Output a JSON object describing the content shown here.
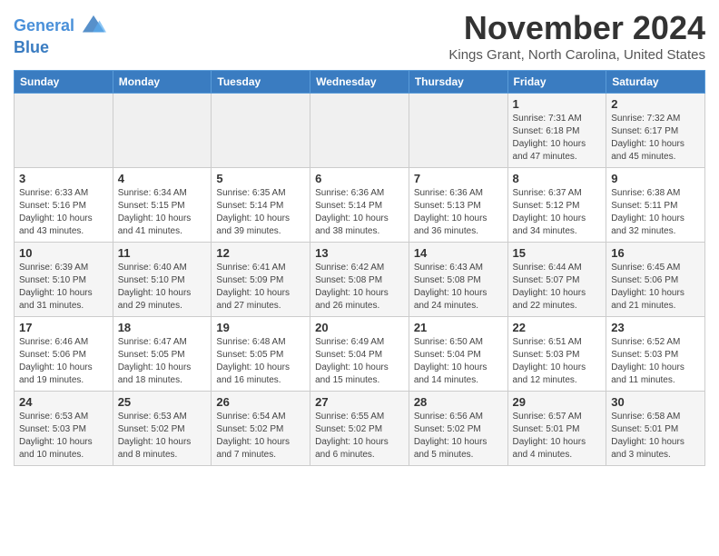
{
  "logo": {
    "line1": "General",
    "line2": "Blue"
  },
  "title": "November 2024",
  "location": "Kings Grant, North Carolina, United States",
  "days_of_week": [
    "Sunday",
    "Monday",
    "Tuesday",
    "Wednesday",
    "Thursday",
    "Friday",
    "Saturday"
  ],
  "weeks": [
    [
      {
        "day": "",
        "content": ""
      },
      {
        "day": "",
        "content": ""
      },
      {
        "day": "",
        "content": ""
      },
      {
        "day": "",
        "content": ""
      },
      {
        "day": "",
        "content": ""
      },
      {
        "day": "1",
        "content": "Sunrise: 7:31 AM\nSunset: 6:18 PM\nDaylight: 10 hours\nand 47 minutes."
      },
      {
        "day": "2",
        "content": "Sunrise: 7:32 AM\nSunset: 6:17 PM\nDaylight: 10 hours\nand 45 minutes."
      }
    ],
    [
      {
        "day": "3",
        "content": "Sunrise: 6:33 AM\nSunset: 5:16 PM\nDaylight: 10 hours\nand 43 minutes."
      },
      {
        "day": "4",
        "content": "Sunrise: 6:34 AM\nSunset: 5:15 PM\nDaylight: 10 hours\nand 41 minutes."
      },
      {
        "day": "5",
        "content": "Sunrise: 6:35 AM\nSunset: 5:14 PM\nDaylight: 10 hours\nand 39 minutes."
      },
      {
        "day": "6",
        "content": "Sunrise: 6:36 AM\nSunset: 5:14 PM\nDaylight: 10 hours\nand 38 minutes."
      },
      {
        "day": "7",
        "content": "Sunrise: 6:36 AM\nSunset: 5:13 PM\nDaylight: 10 hours\nand 36 minutes."
      },
      {
        "day": "8",
        "content": "Sunrise: 6:37 AM\nSunset: 5:12 PM\nDaylight: 10 hours\nand 34 minutes."
      },
      {
        "day": "9",
        "content": "Sunrise: 6:38 AM\nSunset: 5:11 PM\nDaylight: 10 hours\nand 32 minutes."
      }
    ],
    [
      {
        "day": "10",
        "content": "Sunrise: 6:39 AM\nSunset: 5:10 PM\nDaylight: 10 hours\nand 31 minutes."
      },
      {
        "day": "11",
        "content": "Sunrise: 6:40 AM\nSunset: 5:10 PM\nDaylight: 10 hours\nand 29 minutes."
      },
      {
        "day": "12",
        "content": "Sunrise: 6:41 AM\nSunset: 5:09 PM\nDaylight: 10 hours\nand 27 minutes."
      },
      {
        "day": "13",
        "content": "Sunrise: 6:42 AM\nSunset: 5:08 PM\nDaylight: 10 hours\nand 26 minutes."
      },
      {
        "day": "14",
        "content": "Sunrise: 6:43 AM\nSunset: 5:08 PM\nDaylight: 10 hours\nand 24 minutes."
      },
      {
        "day": "15",
        "content": "Sunrise: 6:44 AM\nSunset: 5:07 PM\nDaylight: 10 hours\nand 22 minutes."
      },
      {
        "day": "16",
        "content": "Sunrise: 6:45 AM\nSunset: 5:06 PM\nDaylight: 10 hours\nand 21 minutes."
      }
    ],
    [
      {
        "day": "17",
        "content": "Sunrise: 6:46 AM\nSunset: 5:06 PM\nDaylight: 10 hours\nand 19 minutes."
      },
      {
        "day": "18",
        "content": "Sunrise: 6:47 AM\nSunset: 5:05 PM\nDaylight: 10 hours\nand 18 minutes."
      },
      {
        "day": "19",
        "content": "Sunrise: 6:48 AM\nSunset: 5:05 PM\nDaylight: 10 hours\nand 16 minutes."
      },
      {
        "day": "20",
        "content": "Sunrise: 6:49 AM\nSunset: 5:04 PM\nDaylight: 10 hours\nand 15 minutes."
      },
      {
        "day": "21",
        "content": "Sunrise: 6:50 AM\nSunset: 5:04 PM\nDaylight: 10 hours\nand 14 minutes."
      },
      {
        "day": "22",
        "content": "Sunrise: 6:51 AM\nSunset: 5:03 PM\nDaylight: 10 hours\nand 12 minutes."
      },
      {
        "day": "23",
        "content": "Sunrise: 6:52 AM\nSunset: 5:03 PM\nDaylight: 10 hours\nand 11 minutes."
      }
    ],
    [
      {
        "day": "24",
        "content": "Sunrise: 6:53 AM\nSunset: 5:03 PM\nDaylight: 10 hours\nand 10 minutes."
      },
      {
        "day": "25",
        "content": "Sunrise: 6:53 AM\nSunset: 5:02 PM\nDaylight: 10 hours\nand 8 minutes."
      },
      {
        "day": "26",
        "content": "Sunrise: 6:54 AM\nSunset: 5:02 PM\nDaylight: 10 hours\nand 7 minutes."
      },
      {
        "day": "27",
        "content": "Sunrise: 6:55 AM\nSunset: 5:02 PM\nDaylight: 10 hours\nand 6 minutes."
      },
      {
        "day": "28",
        "content": "Sunrise: 6:56 AM\nSunset: 5:02 PM\nDaylight: 10 hours\nand 5 minutes."
      },
      {
        "day": "29",
        "content": "Sunrise: 6:57 AM\nSunset: 5:01 PM\nDaylight: 10 hours\nand 4 minutes."
      },
      {
        "day": "30",
        "content": "Sunrise: 6:58 AM\nSunset: 5:01 PM\nDaylight: 10 hours\nand 3 minutes."
      }
    ]
  ]
}
